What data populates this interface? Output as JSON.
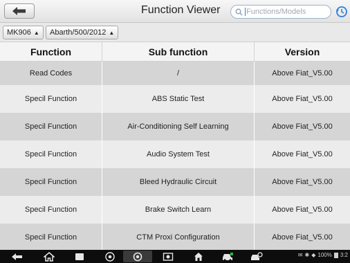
{
  "header": {
    "title": "Function Viewer",
    "search_placeholder": "Functions/Models"
  },
  "breadcrumbs": [
    {
      "label": "MK906"
    },
    {
      "label": "Abarth/500/2012"
    }
  ],
  "table": {
    "columns": [
      "Function",
      "Sub function",
      "Version"
    ],
    "rows": [
      {
        "function": "Read Codes",
        "sub_function": "/",
        "version": "Above Fiat_V5.00"
      },
      {
        "function": "Specil Function",
        "sub_function": "ABS Static Test",
        "version": "Above Fiat_V5.00"
      },
      {
        "function": "Specil Function",
        "sub_function": "Air-Conditioning Self Learning",
        "version": "Above Fiat_V5.00"
      },
      {
        "function": "Specil Function",
        "sub_function": "Audio System Test",
        "version": "Above Fiat_V5.00"
      },
      {
        "function": "Specil Function",
        "sub_function": "Bleed Hydraulic Circuit",
        "version": "Above Fiat_V5.00"
      },
      {
        "function": "Specil Function",
        "sub_function": "Brake Switch Learn",
        "version": "Above Fiat_V5.00"
      },
      {
        "function": "Specil Function",
        "sub_function": "CTM Proxi Configuration",
        "version": "Above Fiat_V5.00"
      }
    ]
  },
  "status_bar": {
    "battery": "100%",
    "time": "3:2"
  },
  "icons": {
    "back": "back-arrow-icon",
    "search": "search-icon",
    "history": "history-icon",
    "nav_back": "nav-back-icon",
    "nav_home": "nav-home-icon",
    "nav_recents": "nav-recents-icon",
    "browser": "browser-icon",
    "camera": "camera-icon",
    "screenshot": "screenshot-icon",
    "house": "house-icon",
    "car": "car-icon",
    "car_settings": "car-settings-icon"
  },
  "colors": {
    "row_dark": "#d5d5d5",
    "row_light": "#ececec",
    "accent": "#3a7bd5"
  }
}
